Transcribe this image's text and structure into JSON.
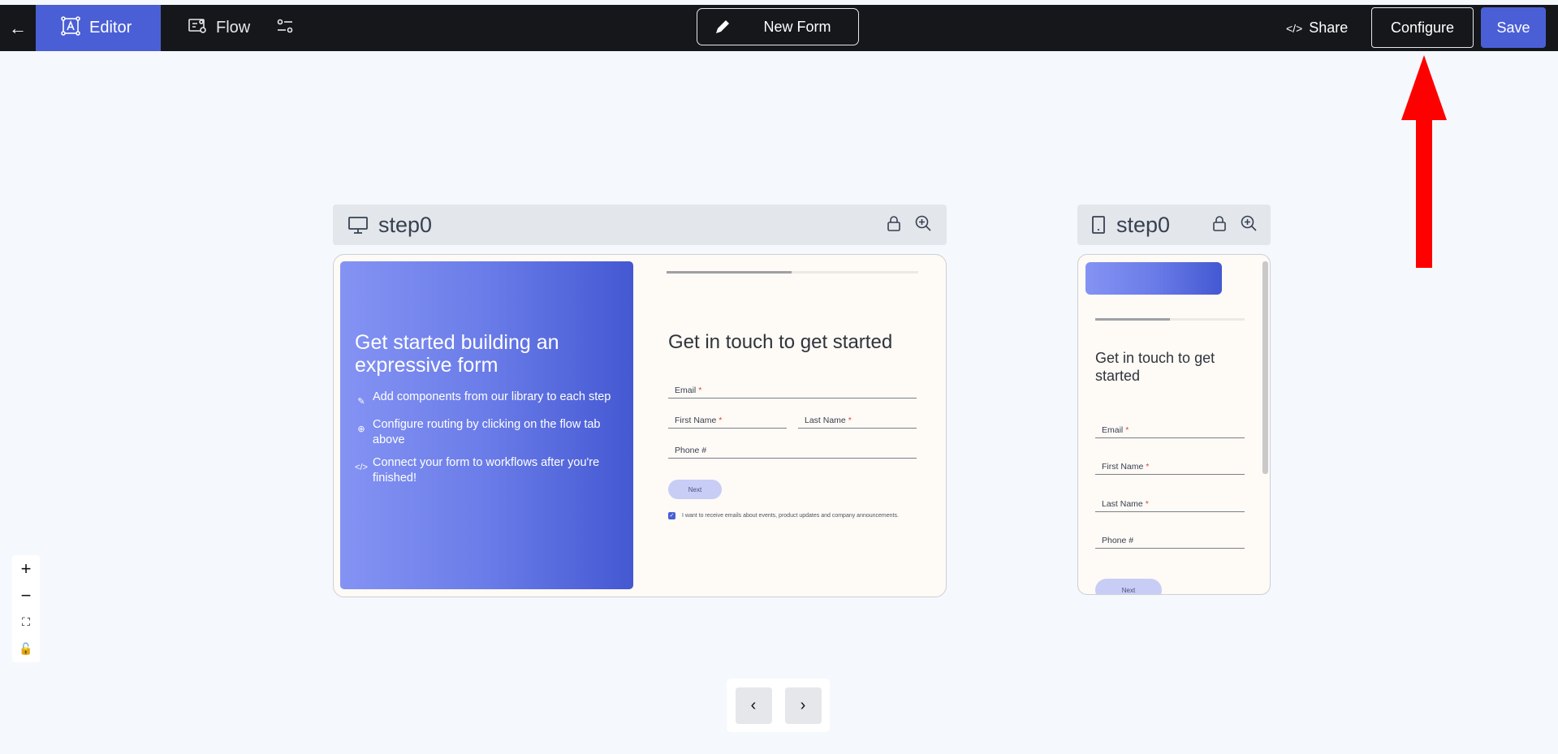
{
  "topbar": {
    "back_label": "←",
    "tabs": [
      {
        "label": "Editor",
        "icon": "text-box-icon",
        "active": true
      },
      {
        "label": "Flow",
        "icon": "flow-icon",
        "active": false
      }
    ],
    "settings_icon": "sliders-icon",
    "form_name": "New Form",
    "share_label": "Share",
    "share_icon": "</>",
    "configure_label": "Configure",
    "save_label": "Save"
  },
  "annotation": {
    "arrow_color": "#ff0000"
  },
  "desktop_step": {
    "name": "step0",
    "hero": {
      "title": "Get started building an expressive form",
      "items": [
        {
          "icon": "pencil-icon",
          "text": "Add components from our library to each step"
        },
        {
          "icon": "globe-icon",
          "text": "Configure routing by clicking on the flow tab above"
        },
        {
          "icon": "code-icon",
          "text": "Connect your form to workflows after you're finished!"
        }
      ]
    },
    "form": {
      "progress": 0.5,
      "heading": "Get in touch to get started",
      "fields": {
        "email": "Email",
        "first_name": "First Name",
        "last_name": "Last Name",
        "phone": "Phone #"
      },
      "required_mark": "*",
      "next_label": "Next",
      "consent_checked": true,
      "consent_text": "I want to receive emails about events, product updates and company announcements."
    }
  },
  "mobile_step": {
    "name": "step0",
    "form": {
      "progress": 0.5,
      "heading": "Get in touch to get started",
      "fields": {
        "email": "Email",
        "first_name": "First Name",
        "last_name": "Last Name",
        "phone": "Phone #"
      },
      "required_mark": "*",
      "next_label": "Next"
    }
  },
  "zoom_controls": {
    "zoom_in": "+",
    "zoom_out": "−",
    "fit": "⛶",
    "lock": "🔓"
  },
  "pager": {
    "prev": "‹",
    "next": "›"
  }
}
